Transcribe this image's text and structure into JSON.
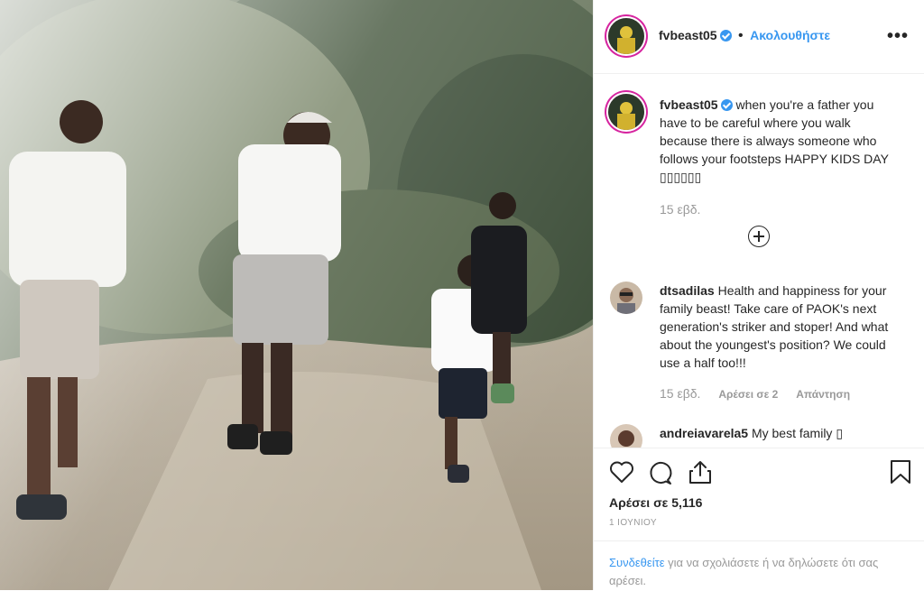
{
  "post": {
    "username": "fvbeast05",
    "follow_label": "Ακολουθήστε",
    "more_label": "•••",
    "caption": "when you're a father you have to be careful where you walk because there is always someone who follows your footsteps HAPPY KIDS DAY ▯▯▯▯▯▯",
    "caption_time": "15 εβδ."
  },
  "comments": [
    {
      "username": "dtsadilas",
      "text": "Health and happiness for your family beast! Take care of PAOK's next generation's striker and stoper! And what about the youngest's position? We could use a half too!!!",
      "time": "15 εβδ.",
      "likes": "Αρέσει σε 2",
      "reply": "Απάντηση"
    },
    {
      "username": "andreiavarela5",
      "text": "My best family ▯"
    }
  ],
  "footer": {
    "likes": "Αρέσει σε 5,116",
    "date": "1 ΙΟΥΝΙΟΥ",
    "login_link": "Συνδεθείτε",
    "login_text": "για να σχολιάσετε ή να δηλώσετε ότι σας αρέσει."
  },
  "icons": {
    "like": "heart-icon",
    "comment": "comment-icon",
    "share": "share-icon",
    "save": "bookmark-icon",
    "load_more": "plus-circle-icon"
  },
  "colors": {
    "accent": "#3897f0",
    "muted": "#999999",
    "text": "#262626"
  }
}
